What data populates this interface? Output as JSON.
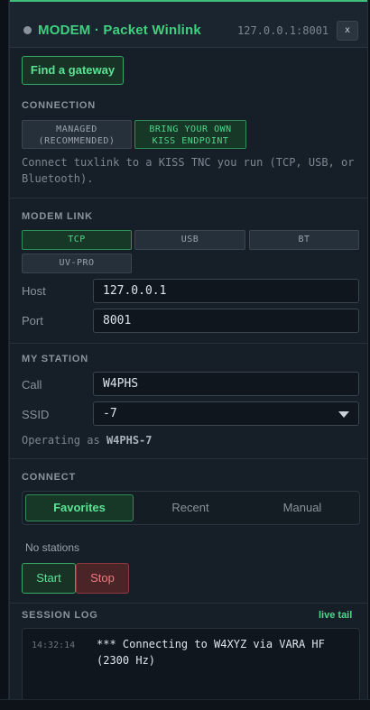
{
  "window": {
    "title": "MODEM · Packet Winlink",
    "endpoint": "127.0.0.1:8001",
    "close_label": "x"
  },
  "gateway_button": "Find a gateway",
  "connection": {
    "label": "CONNECTION",
    "modes": [
      {
        "line1": "MANAGED",
        "line2": "(RECOMMENDED)",
        "active": false
      },
      {
        "line1": "BRING YOUR OWN",
        "line2": "KISS ENDPOINT",
        "active": true
      }
    ],
    "hint": "Connect tuxlink to a KISS TNC you run (TCP, USB, or Bluetooth)."
  },
  "modem_link": {
    "label": "MODEM LINK",
    "options": [
      {
        "label": "TCP",
        "active": true
      },
      {
        "label": "USB",
        "active": false
      },
      {
        "label": "BT",
        "active": false
      },
      {
        "label": "UV-PRO",
        "active": false
      }
    ],
    "host_label": "Host",
    "host_value": "127.0.0.1",
    "port_label": "Port",
    "port_value": "8001"
  },
  "station": {
    "label": "MY STATION",
    "call_label": "Call",
    "call_value": "W4PHS",
    "ssid_label": "SSID",
    "ssid_value": "-7",
    "operating_prefix": "Operating as",
    "operating_value": "W4PHS-7"
  },
  "connect": {
    "label": "CONNECT",
    "tabs": [
      "Favorites",
      "Recent",
      "Manual"
    ],
    "active_tab": 0,
    "empty_text": "No stations",
    "start_label": "Start",
    "stop_label": "Stop"
  },
  "session_log": {
    "label": "SESSION LOG",
    "live_tail_label": "live tail",
    "entries": [
      {
        "time": "14:32:14",
        "message": "*** Connecting to W4XYZ via VARA HF (2300 Hz)"
      }
    ]
  },
  "colors": {
    "accent_green": "#3fd07e",
    "stop_red": "#f07a7f",
    "panel_bg": "#161f28"
  }
}
